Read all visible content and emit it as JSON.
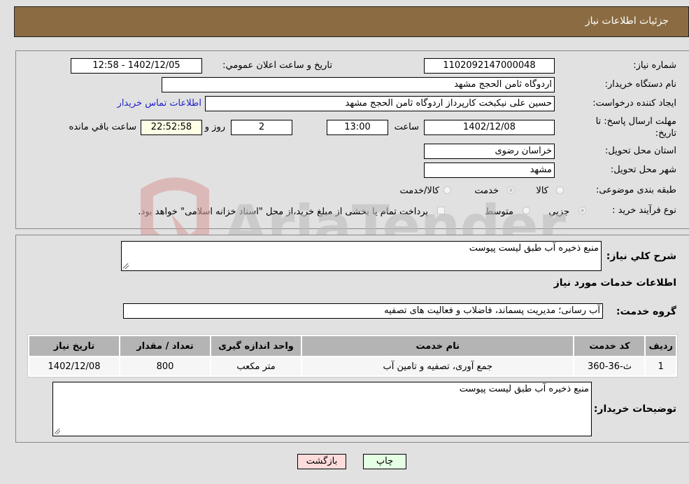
{
  "header": {
    "title": "جزئيات اطلاعات نياز"
  },
  "fields": {
    "need_number": {
      "label": "شماره نیاز:",
      "value": "1102092147000048"
    },
    "announce_datetime": {
      "label": "تاريخ و ساعت اعلان عمومي:",
      "value": "1402/12/05 - 12:58"
    },
    "buyer_org": {
      "label": "نام دستگاه خريدار:",
      "value": "اردوگاه ثامن الحجج مشهد"
    },
    "requester": {
      "label": "ايجاد کننده درخواست:",
      "value": "حسين علی نيکبخت کارپرداز اردوگاه ثامن الحجج مشهد"
    },
    "buyer_contact_link": "اطلاعات تماس خريدار",
    "deadline": {
      "label_line1": "مهلت ارسال پاسخ: تا",
      "label_line2": "تاريخ:",
      "date": "1402/12/08",
      "time_label": "ساعت",
      "time": "13:00",
      "days": "2",
      "days_label": "روز و",
      "remaining": "22:52:58",
      "remaining_label": "ساعت باقي مانده"
    },
    "province": {
      "label": "استان محل تحويل:",
      "value": "خراسان رضوی"
    },
    "city": {
      "label": "شهر محل تحويل:",
      "value": "مشهد"
    },
    "category": {
      "label": "طبقه بندی موضوعی:",
      "options": [
        "کالا",
        "خدمت",
        "کالا/خدمت"
      ],
      "selected": "خدمت"
    },
    "purchase_process": {
      "label": "نوع فرآيند خريد :",
      "options": [
        "جزيي",
        "متوسط"
      ],
      "selected": "جزيي",
      "treasury_note": "پرداخت تمام يا بخشی از مبلغ خريد،از محل \"اسناد خزانه اسلامی\" خواهد بود."
    }
  },
  "details": {
    "general_description": {
      "label": "شرح کلي نياز:",
      "value": "منبع ذخيره آب طبق ليست پيوست"
    },
    "services_heading": "اطلاعات خدمات مورد نياز",
    "service_group": {
      "label": "گروه خدمت:",
      "value": "آب رسانی؛ مديريت پسماند، فاضلاب و فعاليت های تصفيه"
    },
    "table": {
      "headers": [
        "رديف",
        "کد خدمت",
        "نام خدمت",
        "واحد اندازه گيری",
        "تعداد / مقدار",
        "تاريخ نياز"
      ],
      "rows": [
        [
          "1",
          "ث-36-360",
          "جمع آوری، تصفيه و تامين آب",
          "متر مکعب",
          "800",
          "1402/12/08"
        ]
      ]
    },
    "buyer_notes": {
      "label": "توضيحات خريدار:",
      "value": "منبع ذخيره آب طبق ليست پيوست"
    }
  },
  "buttons": {
    "print": "چاپ",
    "back": "بازگشت"
  },
  "watermark": {
    "text": "AriaTender.neT"
  },
  "colors": {
    "header_bg": "#8b6c42",
    "link": "#2020c8",
    "back_btn": "#ffdcdc",
    "print_btn": "#e4ffe4"
  }
}
